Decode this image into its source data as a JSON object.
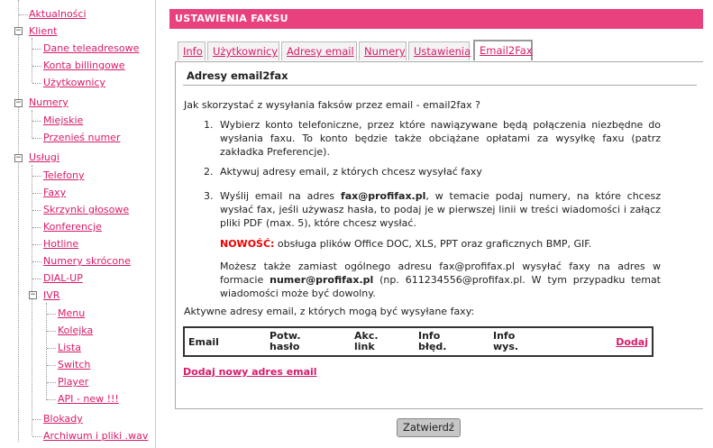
{
  "sidebar": {
    "items": [
      {
        "label": "Aktualności"
      },
      {
        "label": "Klient"
      },
      {
        "label": "Dane teleadresowe"
      },
      {
        "label": "Konta billingowe"
      },
      {
        "label": "Użytkownicy"
      },
      {
        "label": "Numery"
      },
      {
        "label": "Miejskie"
      },
      {
        "label": "Przenieś numer"
      },
      {
        "label": "Usługi"
      },
      {
        "label": "Telefony"
      },
      {
        "label": "Faxy"
      },
      {
        "label": "Skrzynki głosowe"
      },
      {
        "label": "Konferencje"
      },
      {
        "label": "Hotline"
      },
      {
        "label": "Numery skrócone"
      },
      {
        "label": "DIAL-UP"
      },
      {
        "label": "IVR"
      },
      {
        "label": "Menu"
      },
      {
        "label": "Kolejka"
      },
      {
        "label": "Lista"
      },
      {
        "label": "Switch"
      },
      {
        "label": "Player"
      },
      {
        "label": "API - new !!!"
      },
      {
        "label": "Blokady"
      },
      {
        "label": "Archiwum i pliki .wav"
      }
    ]
  },
  "header": {
    "title": "USTAWIENIA FAKSU"
  },
  "tabs": [
    {
      "label": "Info"
    },
    {
      "label": "Użytkownicy"
    },
    {
      "label": "Adresy email"
    },
    {
      "label": "Numery"
    },
    {
      "label": "Ustawienia"
    },
    {
      "label": "Email2Fax"
    }
  ],
  "panel": {
    "title": "Adresy email2fax",
    "intro": "Jak skorzystać z wysyłania faksów przez email - email2fax ?",
    "step1": "Wybierz konto telefoniczne, przez które nawiązywane będą połączenia niezbędne do wysłania faxu. To konto będzie także obciążane opłatami za wysyłkę faxu (patrz zakładka Preferencje).",
    "step2": "Aktywuj adresy email, z których chcesz wysyłać faxy",
    "step3_a": "Wyślij email na adres ",
    "step3_email": "fax@profifax.pl",
    "step3_b": ", w temacie podaj numery, na które chcesz wysłać fax, jeśli używasz hasła, to podaj je w pierwszej linii w treści wiadomości i załącz pliki PDF (max. 5), które chcesz wysłać.",
    "news_label": "NOWOŚĆ:",
    "news_text": " obsługa plików Office DOC, XLS, PPT oraz graficznych BMP, GIF.",
    "extra_a": "Możesz także zamiast ogólnego adresu fax@profifax.pl wysyłać faxy na adres w formacie ",
    "extra_format": "numer@profifax.pl",
    "extra_b": " (np. 611234556@profifax.pl. W tym przypadku temat wiadomości może być dowolny.",
    "active_label": "Aktywne adresy email, z których mogą być wysyłane faxy:",
    "table_headers": {
      "email": "Email",
      "potw_1": "Potw.",
      "potw_2": "hasło",
      "akc_1": "Akc.",
      "akc_2": "link",
      "info_bl_1": "Info",
      "info_bl_2": "błęd.",
      "info_wys_1": "Info",
      "info_wys_2": "wys.",
      "add": "Dodaj"
    },
    "add_new": "Dodaj nowy adres email"
  },
  "submit_label": "Zatwierdź"
}
